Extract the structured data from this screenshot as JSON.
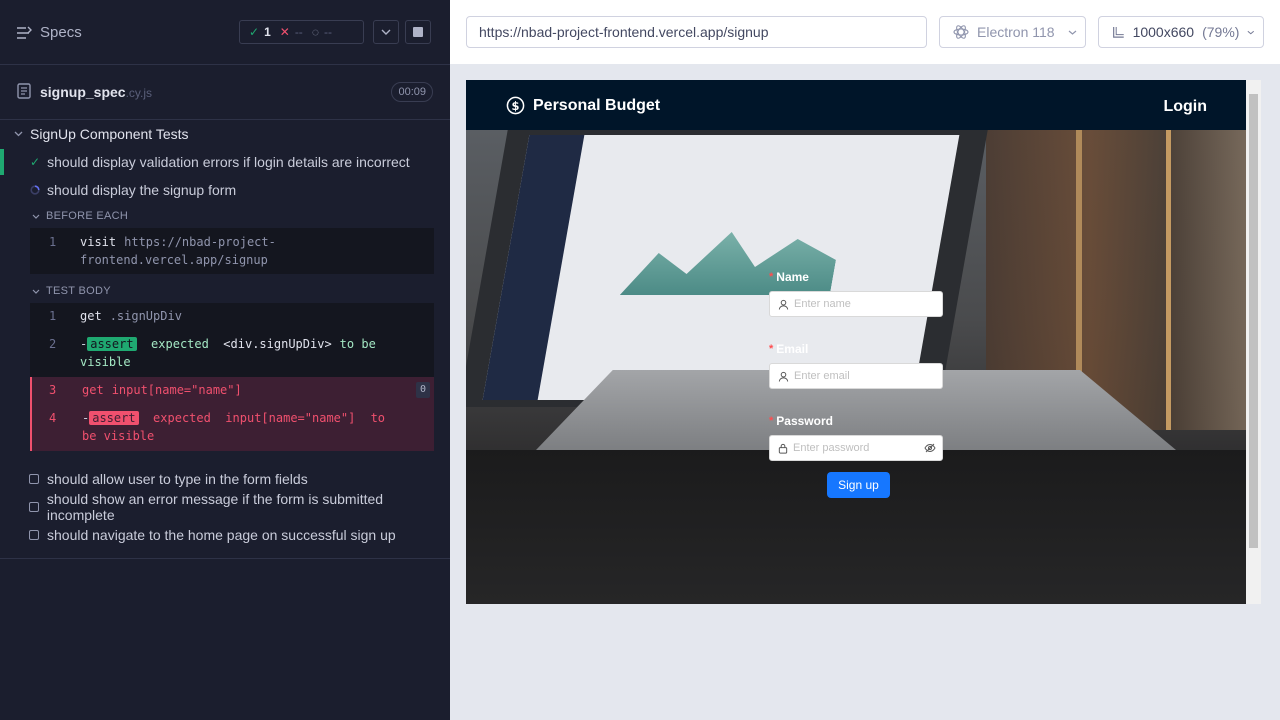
{
  "reporter": {
    "specs_label": "Specs",
    "stats": {
      "passed": "1",
      "failed": "--",
      "pending": "--"
    },
    "spec": {
      "name": "signup_spec",
      "ext": ".cy.js",
      "duration": "00:09"
    },
    "suite_title": "SignUp Component Tests",
    "tests": [
      {
        "title": "should display validation errors if login details are incorrect",
        "state": "passed"
      },
      {
        "title": "should display the signup form",
        "state": "running"
      }
    ],
    "before_each": {
      "title": "BEFORE EACH",
      "commands": [
        {
          "num": "1",
          "name": "visit",
          "arg": "https://nbad-project-frontend.vercel.app/signup"
        }
      ]
    },
    "test_body": {
      "title": "TEST BODY",
      "commands": [
        {
          "num": "1",
          "name": "get",
          "arg": ".signUpDiv"
        },
        {
          "num": "2",
          "badge": "assert",
          "word": "expected",
          "sel": "<div.signUpDiv>",
          "tobe": "to be visible"
        },
        {
          "num": "3",
          "name": "get",
          "arg": "input[name=\"name\"]",
          "count": "0"
        },
        {
          "num": "4",
          "badge": "assert",
          "word": "expected",
          "sel": "input[name=\"name\"]",
          "tobe": "to be visible"
        }
      ]
    },
    "pending_tests": [
      "should allow user to type in the form fields",
      "should show an error message if the form is submitted incomplete",
      "should navigate to the home page on successful sign up"
    ]
  },
  "runner": {
    "url": "https://nbad-project-frontend.vercel.app/signup",
    "browser": "Electron 118",
    "viewport": "1000x660",
    "viewport_pct": "(79%)"
  },
  "app": {
    "brand": "Personal Budget",
    "login": "Login",
    "form": {
      "name_label": "Name",
      "name_placeholder": "Enter name",
      "email_label": "Email",
      "email_placeholder": "Enter email",
      "password_label": "Password",
      "password_placeholder": "Enter password",
      "submit": "Sign up"
    }
  },
  "colors": {
    "pass": "#1fa971",
    "fail": "#f0506e",
    "nav_bg": "#001529",
    "primary": "#1677ff"
  }
}
